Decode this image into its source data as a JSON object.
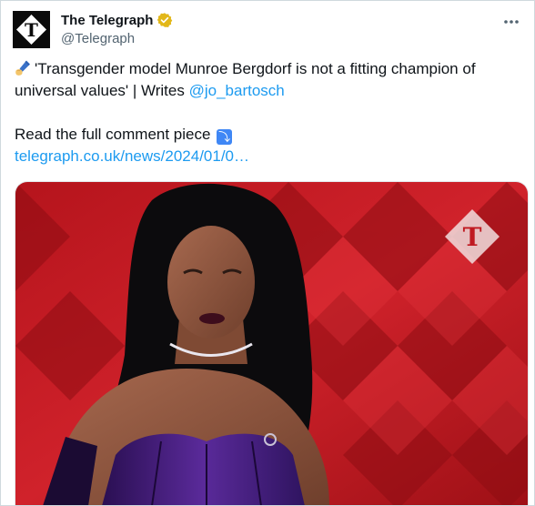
{
  "account": {
    "display_name": "The Telegraph",
    "handle": "@Telegraph",
    "verified": true,
    "avatar_icon": "telegraph-t-logo",
    "badge_color": "#e2b719"
  },
  "tweet": {
    "text_line1": "'Transgender model Munroe Bergdorf is not a fitting champion of",
    "text_line2_prefix": "universal values' | Writes ",
    "mention": "@jo_bartosch",
    "read_more": "Read the full comment piece",
    "link": "telegraph.co.uk/news/2024/01/0…",
    "emojis": [
      "writing-hand-icon",
      "arrow-curving-down-icon"
    ]
  },
  "media": {
    "watermark_icon": "telegraph-t-diamond",
    "dominant_colors": [
      "#c41a22",
      "#4a1e7a",
      "#8a4f3a"
    ]
  },
  "colors": {
    "link": "#1d9bf0",
    "text": "#0f1419",
    "secondary": "#536471",
    "border": "#cfd9de"
  }
}
